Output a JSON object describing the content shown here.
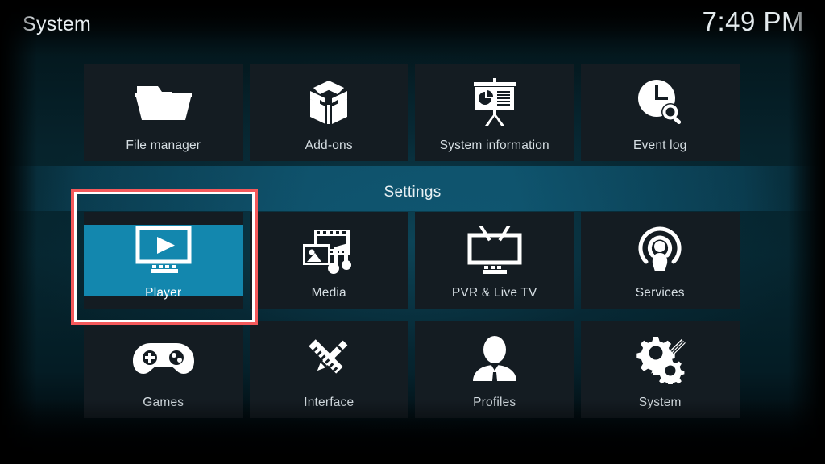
{
  "header": {
    "title": "System",
    "clock": "7:49 PM"
  },
  "section": {
    "settings_label": "Settings"
  },
  "theme": {
    "tile_bg": "#141c22",
    "focus_fill": "#1387ae",
    "annotation_border": "#f4595b",
    "annotation_inner": "#ffffff",
    "text_primary": "#d7dfe4",
    "background_teal": "#062630"
  },
  "rows": [
    {
      "name": "utilities-row",
      "tiles": [
        {
          "label": "File manager",
          "icon": "folder-icon",
          "focused": false
        },
        {
          "label": "Add-ons",
          "icon": "open-box-icon",
          "focused": false
        },
        {
          "label": "System information",
          "icon": "presentation-board-icon",
          "focused": false
        },
        {
          "label": "Event log",
          "icon": "clock-search-icon",
          "focused": false
        }
      ]
    },
    {
      "name": "settings-row-1",
      "tiles": [
        {
          "label": "Player",
          "icon": "monitor-play-icon",
          "focused": true
        },
        {
          "label": "Media",
          "icon": "media-library-icon",
          "focused": false
        },
        {
          "label": "PVR & Live TV",
          "icon": "tv-antenna-icon",
          "focused": false
        },
        {
          "label": "Services",
          "icon": "broadcast-user-icon",
          "focused": false
        }
      ]
    },
    {
      "name": "settings-row-2",
      "tiles": [
        {
          "label": "Games",
          "icon": "gamepad-icon",
          "focused": false
        },
        {
          "label": "Interface",
          "icon": "pencil-ruler-icon",
          "focused": false
        },
        {
          "label": "Profiles",
          "icon": "person-silhouette-icon",
          "focused": false
        },
        {
          "label": "System",
          "icon": "gears-screwdriver-icon",
          "focused": false
        }
      ]
    }
  ]
}
